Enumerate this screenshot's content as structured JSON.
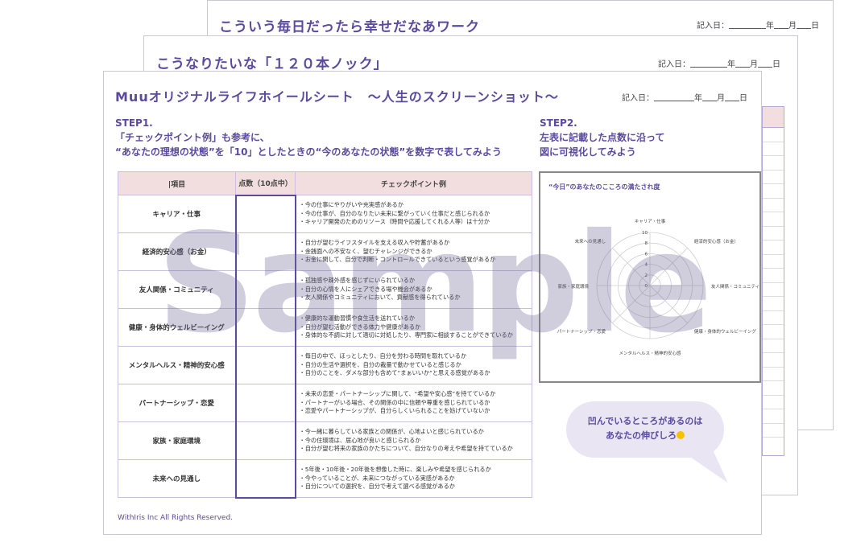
{
  "back_sheet": {
    "title": "こういう毎日だったら幸せだなあワーク",
    "date_label": "記入日："
  },
  "mid_sheet": {
    "title": "こうなりたいな「１２０本ノック」",
    "date_label": "記入日："
  },
  "front_sheet": {
    "title": "Muuオリジナルライフホイールシート　～人生のスクリーンショット～",
    "date_label": "記入日：",
    "date_units": [
      "年",
      "月",
      "日"
    ],
    "step1": {
      "heading": "STEP1.",
      "line1": "「チェックポイント例」も参考に、",
      "line2": "“あなたの理想の状態”を「10」としたときの“今のあなたの状態”を数字で表してみよう"
    },
    "step2": {
      "heading": "STEP2.",
      "line1": "左表に記載した点数に沿って",
      "line2": "図に可視化してみよう"
    },
    "table": {
      "headers": [
        "|項目",
        "点数（10点中）",
        "チェックポイント例"
      ],
      "rows": [
        {
          "item": "キャリア・仕事",
          "points": [
            "・今の仕事にやりがいや充実感があるか",
            "・今の仕事が、自分のなりたい未来に繋がっていく仕事だと感じられるか",
            "・キャリア開発のためのリソース（時間や応援してくれる人等）は十分か"
          ]
        },
        {
          "item": "経済的安心感（お金）",
          "points": [
            "・自分が望むライフスタイルを支える収入や貯蓄があるか",
            "・金銭面への不安なく、望むチャレンジができるか",
            "・お金に関して、自分で判断・コントロールできているという感覚があるか"
          ]
        },
        {
          "item": "友人関係・コミュニティ",
          "points": [
            "・孤独感や疎外感を感じずにいられているか",
            "・自分の心情を人にシェアできる場や機会があるか",
            "・友人関係やコミュニティにおいて、貢献感を得られているか"
          ]
        },
        {
          "item": "健康・身体的ウェルビーイング",
          "points": [
            "・健康的な運動習慣や食生活を送れているか",
            "・自分が望む活動ができる体力や健康があるか",
            "・身体的な不調に対して適切に対処したり、専門家に相談することができているか"
          ]
        },
        {
          "item": "メンタルヘルス・精神的安心感",
          "points": [
            "・毎日の中で、ほっとしたり、自分を労わる時間を取れているか",
            "・自分の生活や選択を、自分の裁量で動かせていると感じるか",
            "・自分のことを、ダメな部分も含めて“まぁいいか”と思える感覚があるか"
          ]
        },
        {
          "item": "パートナーシップ・恋愛",
          "points": [
            "・未来の恋愛・パートナーシップに関して、“希望や安心感”を持てているか",
            "・パートナーがいる場合、その関係の中に信頼や尊重を感じられているか",
            "・恋愛やパートナーシップが、自分らしくいられることを妨げていないか"
          ]
        },
        {
          "item": "家族・家庭環境",
          "points": [
            "・今一緒に暮らしている家族との関係が、心地よいと感じられているか",
            "・今の住環境は、居心地が良いと感じられるか",
            "・自分が望む将来の家族のかたちについて、自分なりの考えや希望を持てているか"
          ]
        },
        {
          "item": "未来への見通し",
          "points": [
            "・5年後・10年後・20年後を想像した時に、楽しみや希望を感じられるか",
            "・今やっていることが、未来につながっている実感があるか",
            "・自分についての選択を、自分で考えて選べる感覚があるか"
          ]
        }
      ]
    },
    "radar": {
      "title": "“今日”のあなたのこころの満たされ度",
      "axes": [
        "キャリア・仕事",
        "経済的安心感（お金）",
        "友人関係・コミュニティ",
        "健康・身体的ウェルビーイング",
        "メンタルヘルス・精神的安心感",
        "パートナーシップ・恋愛",
        "家族・家庭環境",
        "未来への見通し"
      ],
      "scale": [
        "10",
        "8",
        "6",
        "4",
        "2",
        "0"
      ]
    },
    "bubble": {
      "line1": "凹んでいるところがあるのは",
      "line2": "あなたの伸びしろ"
    },
    "footer": "WithIris Inc All Rights Reserved."
  },
  "watermark": "Sample",
  "colors": {
    "accent": "#5b4a9e",
    "header_bg": "#f2dede",
    "bubble_bg": "#e9e5f3",
    "sun": "#f6c200"
  }
}
